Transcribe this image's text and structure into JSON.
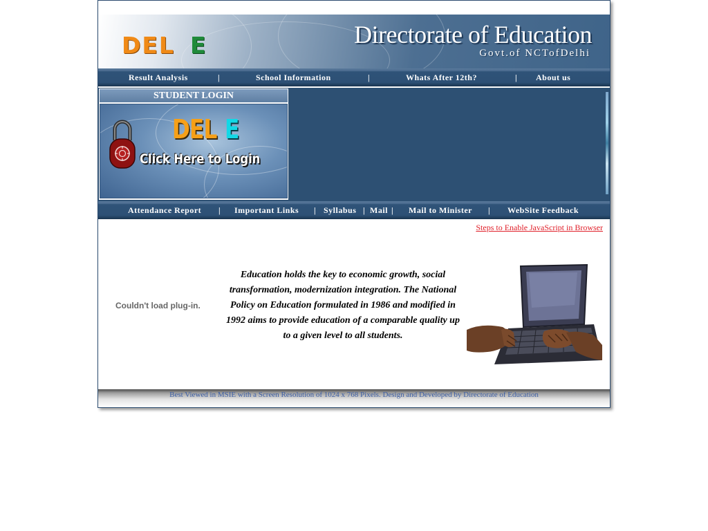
{
  "header": {
    "logo_main": "DEL",
    "logo_e": "E",
    "title": "Directorate of Education",
    "subtitle": "Govt.of NCTofDelhi"
  },
  "top_nav": {
    "items": [
      "Result Analysis",
      "School Information",
      "Whats After 12th?",
      "About us"
    ],
    "separator": "|"
  },
  "login": {
    "header": "STUDENT LOGIN",
    "logo_main": "DEL",
    "logo_e": "E",
    "button_text": "Click Here to Login"
  },
  "bottom_nav": {
    "items": [
      "Attendance Report",
      "Important Links",
      "Syllabus",
      "Mail",
      "Mail to Minister",
      "WebSite Feedback"
    ],
    "separator": "|"
  },
  "content": {
    "js_link": "Steps to Enable JavaScript in Browser",
    "plugin_message": "Couldn't load plug-in.",
    "quote": "Education holds the key to economic growth, social transformation, modernization integration. The National Policy on Education formulated in 1986 and modified in 1992 aims to provide education of a comparable quality up to a given level to all students."
  },
  "footer": {
    "text": "Best Viewed in MSIE with a Screen Resolution of 1024 x 768 Pixels. Design and Developed by Directorate of Education"
  },
  "icons": {
    "login": "padlock-icon",
    "illustration": "laptop-hands-icon"
  },
  "colors": {
    "nav_blue": "#2d5075",
    "link_red": "#e0202a",
    "footer_text": "#3d5fa5",
    "logo_orange": "#f08a17",
    "logo_green": "#1f8a3a"
  }
}
